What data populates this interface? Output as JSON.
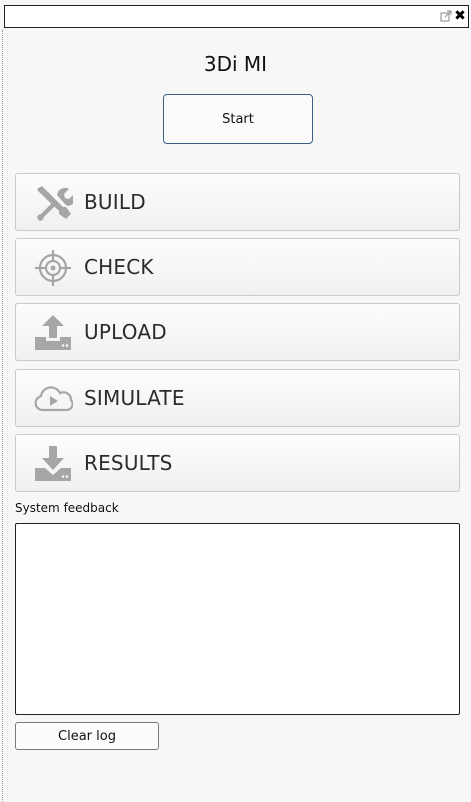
{
  "titlebar": {
    "float_icon": "float-window-icon",
    "close_icon": "close-icon",
    "close_glyph": "✖"
  },
  "app_title": "3Di MI",
  "start_label": "Start",
  "steps": [
    {
      "label": "BUILD",
      "icon": "tools-icon"
    },
    {
      "label": "CHECK",
      "icon": "target-icon"
    },
    {
      "label": "UPLOAD",
      "icon": "upload-icon"
    },
    {
      "label": "SIMULATE",
      "icon": "cloud-play-icon"
    },
    {
      "label": "RESULTS",
      "icon": "download-icon"
    }
  ],
  "feedback": {
    "label": "System feedback",
    "value": ""
  },
  "clear_label": "Clear log",
  "colors": {
    "icon_gray": "#a6a6a6",
    "start_border": "#3b5f86"
  }
}
